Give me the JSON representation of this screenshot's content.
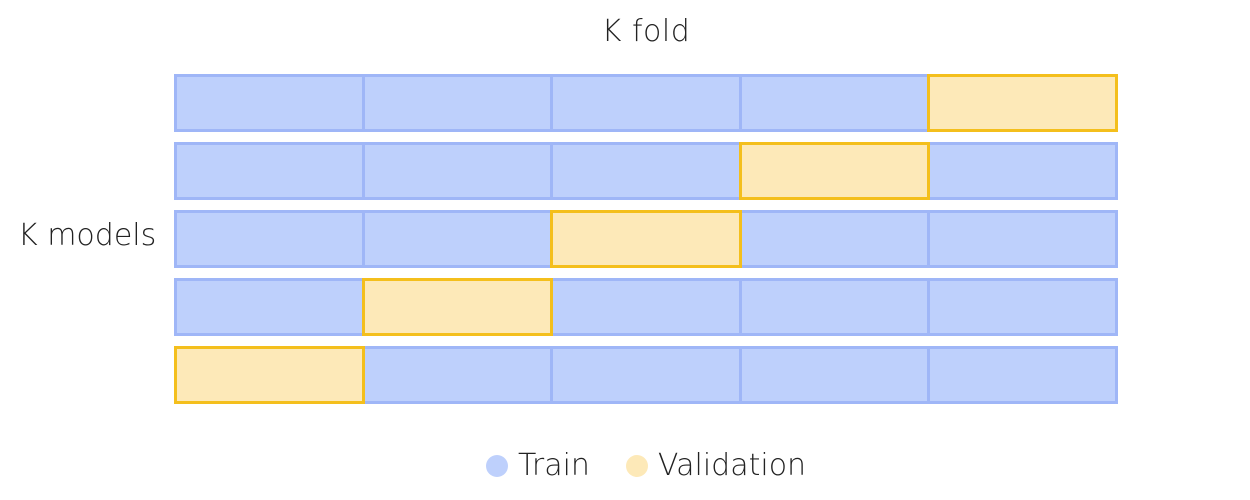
{
  "title": "K fold",
  "row_label": "K models",
  "colors": {
    "train_fill": "#bed0fc",
    "train_border": "#9fb6f7",
    "validation_fill": "#fde9b8",
    "validation_border": "#f4bf1c"
  },
  "folds": 5,
  "models": [
    {
      "validation_fold": 5
    },
    {
      "validation_fold": 4
    },
    {
      "validation_fold": 3
    },
    {
      "validation_fold": 2
    },
    {
      "validation_fold": 1
    }
  ],
  "legend": [
    {
      "label": "Train",
      "color": "#bed0fc"
    },
    {
      "label": "Validation",
      "color": "#fde9b8"
    }
  ]
}
